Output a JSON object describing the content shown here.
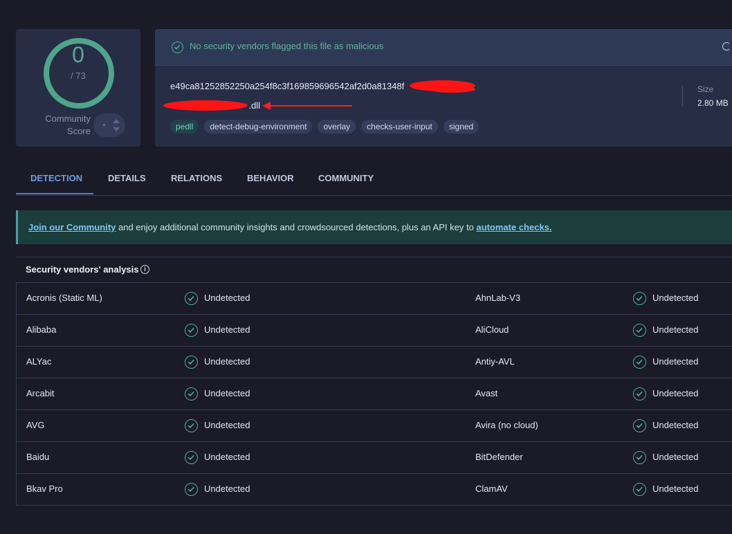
{
  "score": {
    "value": "0",
    "total": "/ 73",
    "community_label_line1": "Community",
    "community_label_line2": "Score"
  },
  "file": {
    "verdict": "No security vendors flagged this file as malicious",
    "hash_visible": "e49ca81252852250a254f8c3f169859696542af2d0a81348f",
    "filename_visible": ".dll",
    "tags": [
      "pedll",
      "detect-debug-environment",
      "overlay",
      "checks-user-input",
      "signed"
    ],
    "size_label": "Size",
    "size_value": "2.80 MB"
  },
  "tabs": [
    {
      "label": "DETECTION",
      "active": true
    },
    {
      "label": "DETAILS",
      "active": false
    },
    {
      "label": "RELATIONS",
      "active": false
    },
    {
      "label": "BEHAVIOR",
      "active": false
    },
    {
      "label": "COMMUNITY",
      "active": false
    }
  ],
  "banner": {
    "link1": "Join our Community",
    "middle": " and enjoy additional community insights and crowdsourced detections, plus an API key to ",
    "link2": "automate checks."
  },
  "vendors": {
    "title": "Security vendors' analysis",
    "rows": [
      {
        "left": {
          "name": "Acronis (Static ML)",
          "result": "Undetected"
        },
        "right": {
          "name": "AhnLab-V3",
          "result": "Undetected"
        }
      },
      {
        "left": {
          "name": "Alibaba",
          "result": "Undetected"
        },
        "right": {
          "name": "AliCloud",
          "result": "Undetected"
        }
      },
      {
        "left": {
          "name": "ALYac",
          "result": "Undetected"
        },
        "right": {
          "name": "Antiy-AVL",
          "result": "Undetected"
        }
      },
      {
        "left": {
          "name": "Arcabit",
          "result": "Undetected"
        },
        "right": {
          "name": "Avast",
          "result": "Undetected"
        }
      },
      {
        "left": {
          "name": "AVG",
          "result": "Undetected"
        },
        "right": {
          "name": "Avira (no cloud)",
          "result": "Undetected"
        }
      },
      {
        "left": {
          "name": "Baidu",
          "result": "Undetected"
        },
        "right": {
          "name": "BitDefender",
          "result": "Undetected"
        }
      },
      {
        "left": {
          "name": "Bkav Pro",
          "result": "Undetected"
        },
        "right": {
          "name": "ClamAV",
          "result": "Undetected"
        }
      }
    ]
  },
  "colors": {
    "accent": "#4fb08f",
    "background": "#1a1b27",
    "card": "#272d45",
    "tab_active": "#6e9ce6",
    "redaction": "#ff1414"
  }
}
